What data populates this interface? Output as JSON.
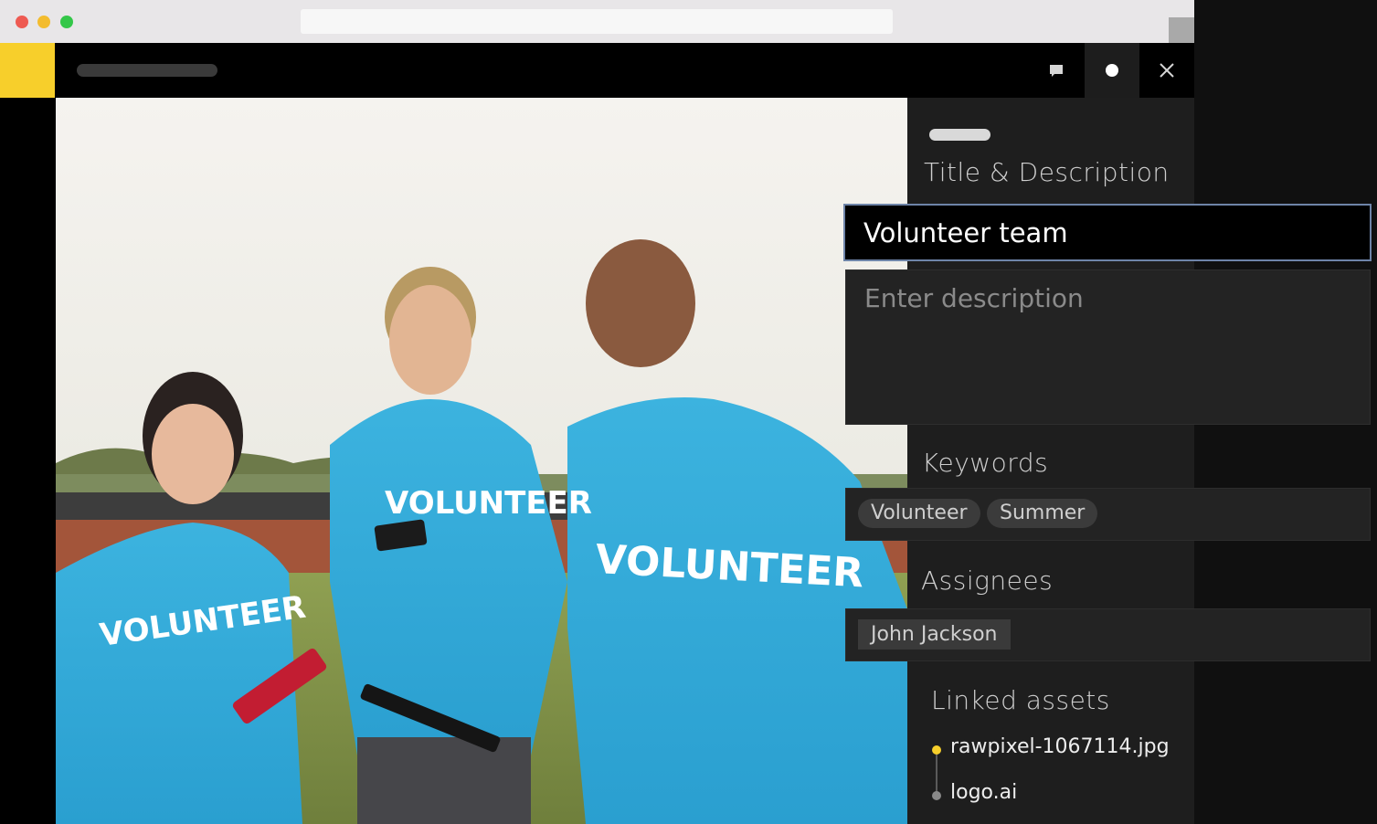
{
  "app": {
    "header_title": "",
    "accent_color": "#f7cf2b",
    "header_icons": [
      "comment-icon",
      "status-dot-icon",
      "close-icon"
    ]
  },
  "panel": {
    "title_section": "Title & Description",
    "title_value": "Volunteer team",
    "description_placeholder": "Enter description",
    "keywords_section": "Keywords",
    "keywords": [
      "Volunteer",
      "Summer"
    ],
    "assignees_section": "Assignees",
    "assignees": [
      "John Jackson"
    ],
    "linked_assets_section": "Linked assets",
    "linked_assets": [
      {
        "name": "rawpixel-1067114.jpg",
        "color": "#f7cf2b"
      },
      {
        "name": "logo.ai",
        "color": "#8a8a8a"
      }
    ]
  },
  "photo": {
    "shirt_text": "VOLUNTEER"
  }
}
